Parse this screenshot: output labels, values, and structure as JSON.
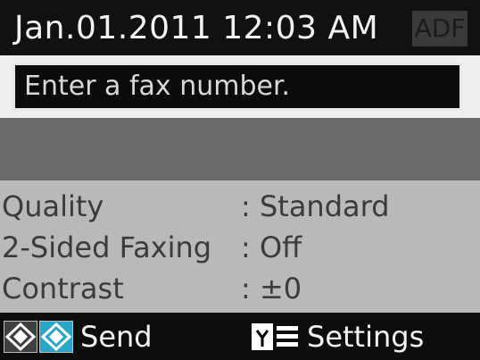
{
  "status_bar": {
    "datetime": "Jan.01.2011  12:03 AM",
    "adf_label": "ADF"
  },
  "fax": {
    "placeholder": "Enter a fax number."
  },
  "settings": [
    {
      "label": "Quality",
      "value": ": Standard"
    },
    {
      "label": "2-Sided Faxing",
      "value": ": Off"
    },
    {
      "label": "Contrast",
      "value": ": ±0"
    }
  ],
  "soft_keys": {
    "send_label": "Send",
    "settings_label": "Settings"
  },
  "colors": {
    "color_start_key": "#2aa6c8",
    "settings_background": "#b9b9b9",
    "fax_area_background": "#6a6a6a"
  },
  "icons": {
    "send_icons": [
      "start-bw-icon",
      "start-color-icon"
    ],
    "settings_icon": "menu-list-icon"
  }
}
